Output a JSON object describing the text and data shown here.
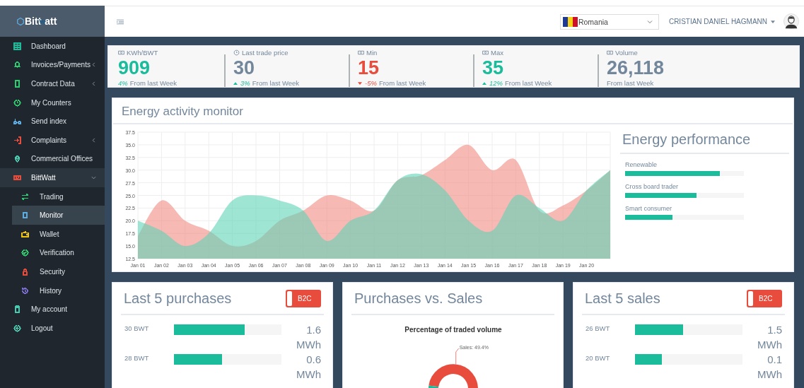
{
  "logo": {
    "text": "Bitt",
    "text_2": "att"
  },
  "sidebar": {
    "items": [
      {
        "label": "Dashboard",
        "color": "#1abc9c",
        "selected": false
      },
      {
        "label": "Invoices/Payments",
        "color": "#2ecc71",
        "selected": false,
        "expanded": false
      },
      {
        "label": "Contract Data",
        "color": "#2ecc71",
        "selected": false,
        "expanded": false
      },
      {
        "label": "My Counters",
        "color": "#2ecc71",
        "selected": false
      },
      {
        "label": "Send index",
        "color": "#5dade2",
        "selected": false
      },
      {
        "label": "Complaints",
        "color": "#e74c3c",
        "selected": false,
        "expanded": false
      },
      {
        "label": "Commercial Offices",
        "color": "#48c9b0",
        "selected": false
      },
      {
        "label": "BittWatt",
        "color": "#e74c3c",
        "selected": false,
        "expanded": true,
        "children": [
          {
            "label": "Trading",
            "color": "#2ecc71",
            "selected": false
          },
          {
            "label": "Monitor",
            "color": "#5dade2",
            "selected": true
          },
          {
            "label": "Wallet",
            "color": "#f1c40f",
            "selected": false
          },
          {
            "label": "Verification",
            "color": "#2ecc71",
            "selected": false
          },
          {
            "label": "Security",
            "color": "#e74c3c",
            "selected": false
          },
          {
            "label": "History",
            "color": "#7d6fd6",
            "selected": false
          }
        ]
      },
      {
        "label": "My account",
        "color": "#48c9b0",
        "selected": false
      },
      {
        "label": "Logout",
        "color": "#48c9b0",
        "selected": false
      }
    ]
  },
  "header": {
    "country": "Romania",
    "user": "CRISTIAN DANIEL HAGMANN"
  },
  "stats": [
    {
      "label": "KWh/BWT",
      "value": "909",
      "color": "#1abc9c",
      "kind": "plain",
      "change": "4%",
      "note": "From last Week"
    },
    {
      "label": "Last trade price",
      "value": "30",
      "color": "#73879c",
      "kind": "up",
      "change": "3%",
      "note": "From last Week"
    },
    {
      "label": "Min",
      "value": "15",
      "color": "#e74c3c",
      "kind": "down",
      "change": "-5%",
      "note": "From last Week"
    },
    {
      "label": "Max",
      "value": "35",
      "color": "#1abc9c",
      "kind": "up",
      "change": "12%",
      "note": "From last Week"
    },
    {
      "label": "Volume",
      "value": "26,118",
      "color": "#73879c",
      "kind": "plain",
      "note": "From last Week"
    }
  ],
  "activity": {
    "title": "Energy activity monitor",
    "chart_data": {
      "type": "area",
      "categories": [
        "Jan 01",
        "Jan 02",
        "Jan 03",
        "Jan 04",
        "Jan 05",
        "Jan 06",
        "Jan 07",
        "Jan 08",
        "Jan 09",
        "Jan 10",
        "Jan 11",
        "Jan 12",
        "Jan 13",
        "Jan 14",
        "Jan 15",
        "Jan 16",
        "Jan 17",
        "Jan 18",
        "Jan 19",
        "Jan 20",
        null
      ],
      "series": [
        {
          "color": "#f08a80",
          "values": [
            17,
            24,
            20,
            18,
            15,
            16,
            20,
            22,
            25,
            24,
            22,
            28,
            29,
            32,
            35,
            30,
            32,
            22,
            23,
            26,
            30
          ]
        },
        {
          "color": "#5fd3b8",
          "values": [
            20,
            18,
            15,
            17.5,
            24,
            25,
            24,
            22,
            16,
            20,
            22,
            28,
            29.2,
            26,
            20,
            18,
            25,
            22.5,
            20,
            26,
            30
          ]
        }
      ],
      "grid": true,
      "ylim": [
        12.5,
        37.5
      ],
      "yticks": [
        12.5,
        {
          "value": 15,
          "label": "15.0"
        },
        17.5,
        {
          "value": 20,
          "label": "20.0"
        },
        22.5,
        {
          "value": 25,
          "label": "25.0"
        },
        27.5,
        {
          "value": 30,
          "label": "30.0"
        },
        32.5,
        {
          "value": 35,
          "label": "35.0"
        },
        37.5
      ]
    }
  },
  "performance": {
    "title": "Energy performance",
    "items": [
      {
        "label": "Renewable",
        "level": 0.8
      },
      {
        "label": "Cross board trader",
        "level": 0.6
      },
      {
        "label": "Smart consumer",
        "level": 0.4
      }
    ]
  },
  "purchases": {
    "title": "Last 5 purchases",
    "toggle": {
      "label": "B2C",
      "on": true
    },
    "rows": [
      {
        "label": "30 BWT",
        "level": 0.66,
        "value": "1.6 MWh"
      },
      {
        "label": "28 BWT",
        "level": 0.45,
        "value": "0.6 MWh"
      }
    ]
  },
  "versus": {
    "title": "Purchases vs. Sales",
    "chart_data": {
      "type": "donut",
      "title": "Percentage of traded volume",
      "categories": [
        "Sales: 49.4%",
        null
      ],
      "values": [
        49.4,
        50.6
      ]
    }
  },
  "sales": {
    "title": "Last 5 sales",
    "toggle": {
      "label": "B2C",
      "on": true
    },
    "rows": [
      {
        "label": "26 BWT",
        "level": 0.45,
        "value": "1.5 MWh"
      },
      {
        "label": "20 BWT",
        "level": 0.25,
        "value": "0.1 MWh"
      }
    ]
  }
}
